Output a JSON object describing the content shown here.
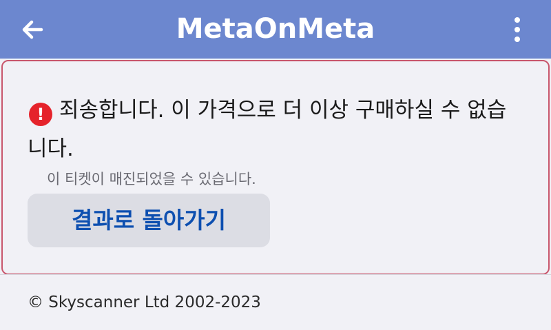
{
  "header": {
    "title": "MetaOnMeta",
    "back_icon": "arrow-left-icon",
    "menu_icon": "more-vertical-icon",
    "background_color": "#6c87cf"
  },
  "error": {
    "icon": "error-circle-icon",
    "icon_glyph": "!",
    "message": "죄송합니다. 이 가격으로 더 이상 구매하실 수 없습니다.",
    "detail": "이 티켓이 매진되었을 수 있습니다.",
    "border_color": "#c8566c"
  },
  "actions": {
    "return_label": "결과로 돌아가기"
  },
  "footer": {
    "copyright": "© Skyscanner Ltd 2002-2023"
  }
}
